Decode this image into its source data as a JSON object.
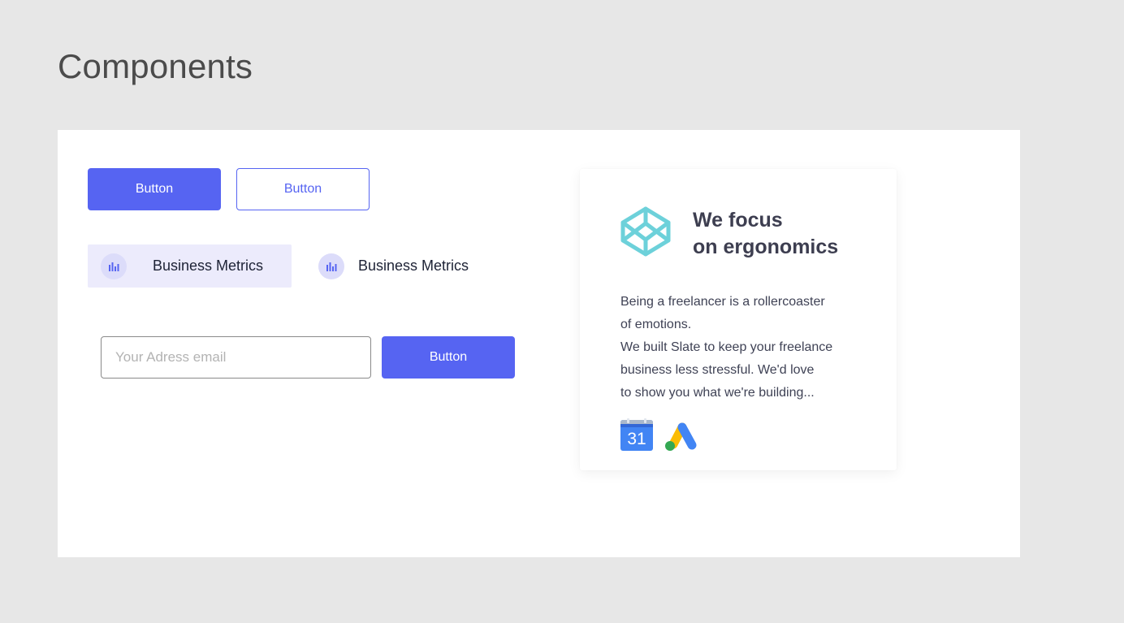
{
  "page": {
    "title": "Components"
  },
  "buttons": {
    "primary_label": "Button",
    "outline_label": "Button",
    "submit_label": "Button"
  },
  "metrics": {
    "active_label": "Business Metrics",
    "inactive_label": "Business Metrics",
    "icon": "bar-chart-icon"
  },
  "email_form": {
    "placeholder": "Your Adress email",
    "value": ""
  },
  "card": {
    "logo_icon": "codepen-icon",
    "title_line1": "We focus",
    "title_line2": "on ergonomics",
    "body_lines": [
      "Being a freelancer is a rollercoaster",
      "of emotions.",
      "We built Slate to keep your freelance",
      "business less stressful. We'd love",
      "to show you what we're building..."
    ],
    "calendar_icon": "google-calendar-icon",
    "calendar_day": "31",
    "ads_icon": "google-ads-icon"
  },
  "colors": {
    "accent": "#5664f2",
    "accent_light": "#ecebfc",
    "logo_teal": "#6dd1da",
    "background": "#e7e7e7",
    "panel": "#ffffff"
  }
}
